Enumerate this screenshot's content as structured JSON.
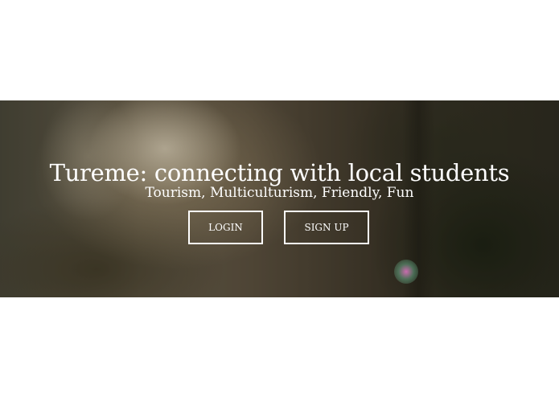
{
  "hero": {
    "headline": "Tureme: connecting with local students",
    "tagline": "Tourism, Multiculturism, Friendly, Fun",
    "login_label": "LOGIN",
    "signup_label": "SIGN UP"
  },
  "colors": {
    "background": "#ffffff",
    "hero_text": "#ffffff",
    "button_border": "#ffffff"
  }
}
